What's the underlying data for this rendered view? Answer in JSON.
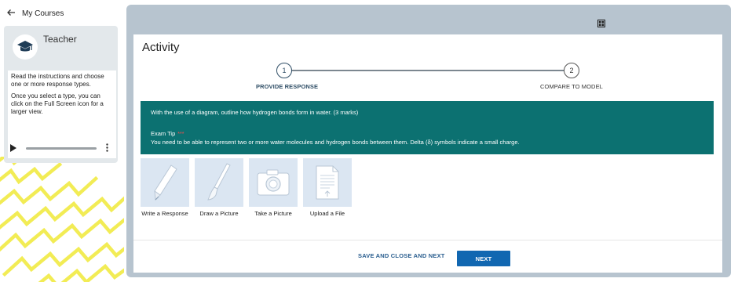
{
  "nav": {
    "back_label": "My Courses",
    "back_icon": "arrow-left-icon"
  },
  "teacher": {
    "name": "Teacher",
    "avatar_icon": "graduation-cap-icon",
    "instructions": [
      "Read the instructions and choose one or more response types.",
      "Once you select a type, you can click on the Full Screen icon for a larger view."
    ],
    "player": {
      "play_icon": "play-icon",
      "menu_icon": "more-vertical-icon"
    }
  },
  "toolbar": {
    "grid_icon": "grid-icon"
  },
  "activity": {
    "title": "Activity",
    "steps": [
      {
        "number": "1",
        "label": "PROVIDE RESPONSE",
        "active": true
      },
      {
        "number": "2",
        "label": "COMPARE TO MODEL",
        "active": false
      }
    ],
    "prompt": {
      "question": "With the use of a diagram, outline how hydrogen bonds form in water. (3 marks)",
      "tip_title": "Exam Tip",
      "tip_mark": "***",
      "tip_text": "You need to be able to represent two or more water molecules and hydrogen bonds between them. Delta (δ) symbols indicate a small charge."
    },
    "options": [
      {
        "label": "Write a Response",
        "icon": "pencil-icon"
      },
      {
        "label": "Draw a Picture",
        "icon": "paintbrush-icon"
      },
      {
        "label": "Take a Picture",
        "icon": "camera-icon"
      },
      {
        "label": "Upload a File",
        "icon": "document-icon"
      }
    ],
    "footer": {
      "save_label": "SAVE AND CLOSE AND NEXT",
      "next_label": "NEXT"
    }
  },
  "colors": {
    "accent": "#1167b1",
    "prompt_bg": "#0c7171",
    "stage_bg": "#b7c4cf",
    "pattern": "#f2ec55"
  }
}
